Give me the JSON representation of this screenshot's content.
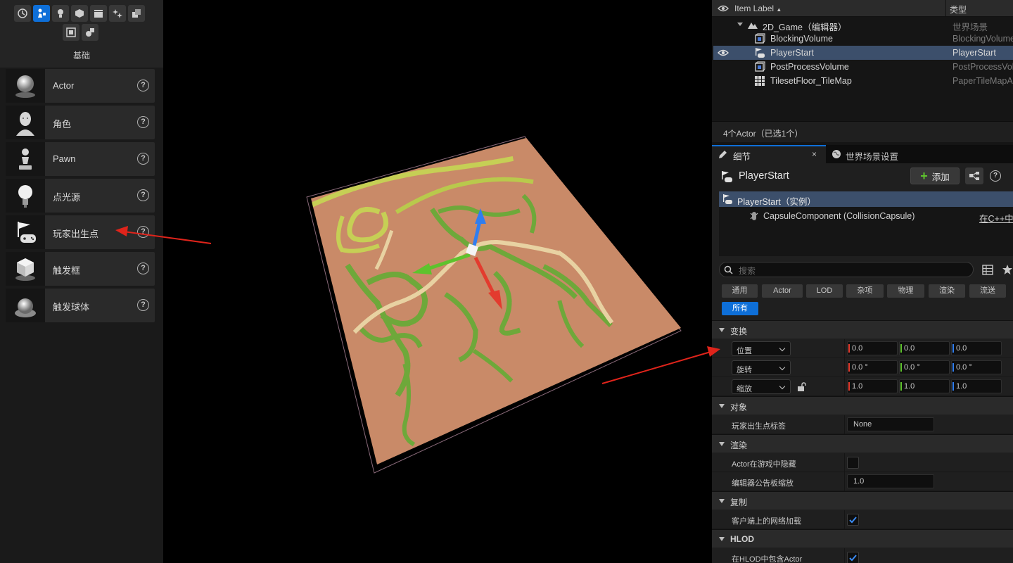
{
  "place_actors": {
    "category_caption": "基础",
    "mode_icons": [
      "recent-icon",
      "basic-icon",
      "lights-icon",
      "shapes-icon",
      "cinematic-icon",
      "visual-effects-icon",
      "geometry-icon",
      "volumes-icon",
      "all-classes-icon"
    ],
    "items": [
      {
        "label": "Actor",
        "icon": "actor-sphere-icon"
      },
      {
        "label": "角色",
        "icon": "character-icon"
      },
      {
        "label": "Pawn",
        "icon": "pawn-icon"
      },
      {
        "label": "点光源",
        "icon": "point-light-icon"
      },
      {
        "label": "玩家出生点",
        "icon": "player-start-icon"
      },
      {
        "label": "触发框",
        "icon": "trigger-box-icon"
      },
      {
        "label": "触发球体",
        "icon": "trigger-sphere-icon"
      }
    ],
    "help_glyph": "?"
  },
  "outliner": {
    "col_label": "Item Label",
    "sort_glyph": "▲",
    "col_type": "类型",
    "rows": [
      {
        "label": "2D_Game（编辑器）",
        "type": "世界场景",
        "icon": "world-icon"
      },
      {
        "label": "BlockingVolume",
        "type": "BlockingVolume",
        "icon": "volume-icon"
      },
      {
        "label": "PlayerStart",
        "type": "PlayerStart",
        "icon": "player-start-icon"
      },
      {
        "label": "PostProcessVolume",
        "type": "PostProcessVolume",
        "icon": "volume-icon"
      },
      {
        "label": "TilesetFloor_TileMap",
        "type": "PaperTileMapActor",
        "icon": "tilemap-icon"
      }
    ],
    "status": "4个Actor（已选1个）"
  },
  "tabs": {
    "details": "细节",
    "world_settings": "世界场景设置",
    "close_glyph": "×"
  },
  "details": {
    "actor_name": "PlayerStart",
    "add_label": "添加",
    "components": {
      "root": "PlayerStart（实例）",
      "child": "CapsuleComponent (CollisionCapsule)",
      "child_note": "在C++中编"
    },
    "search_placeholder": "搜索",
    "filters": [
      "通用",
      "Actor",
      "LOD",
      "杂项",
      "物理",
      "渲染",
      "流送"
    ],
    "filter_all": "所有",
    "sections": {
      "transform": "变换",
      "object": "对象",
      "rendering": "渲染",
      "replication": "复制",
      "hlod": "HLOD"
    },
    "transform": {
      "location": {
        "label": "位置",
        "x": "0.0",
        "y": "0.0",
        "z": "0.0"
      },
      "rotation": {
        "label": "旋转",
        "x": "0.0 °",
        "y": "0.0 °",
        "z": "0.0 °"
      },
      "scale": {
        "label": "缩放",
        "x": "1.0",
        "y": "1.0",
        "z": "1.0"
      }
    },
    "object": {
      "player_start_tag_label": "玩家出生点标签",
      "player_start_tag_value": "None"
    },
    "rendering": {
      "hidden_in_game_label": "Actor在游戏中隐藏",
      "hidden_in_game": false,
      "billboard_scale_label": "编辑器公告板缩放",
      "billboard_scale": "1.0"
    },
    "replication": {
      "net_load_on_client_label": "客户端上的网络加载",
      "net_load_on_client": true
    },
    "hlod": {
      "include_in_hlod_label": "在HLOD中包含Actor",
      "include_in_hlod": true
    }
  },
  "colors": {
    "accent": "#0e6fd8",
    "selection": "#3c4f6b",
    "annotation_arrow": "#e0241b",
    "tile_ground": "#c98a68",
    "tile_grass": "#6ea83a",
    "tile_path": "#e8d2a2",
    "axis_x": "#e33b2e",
    "axis_y": "#5ec32d",
    "axis_z": "#2f7ef0"
  }
}
